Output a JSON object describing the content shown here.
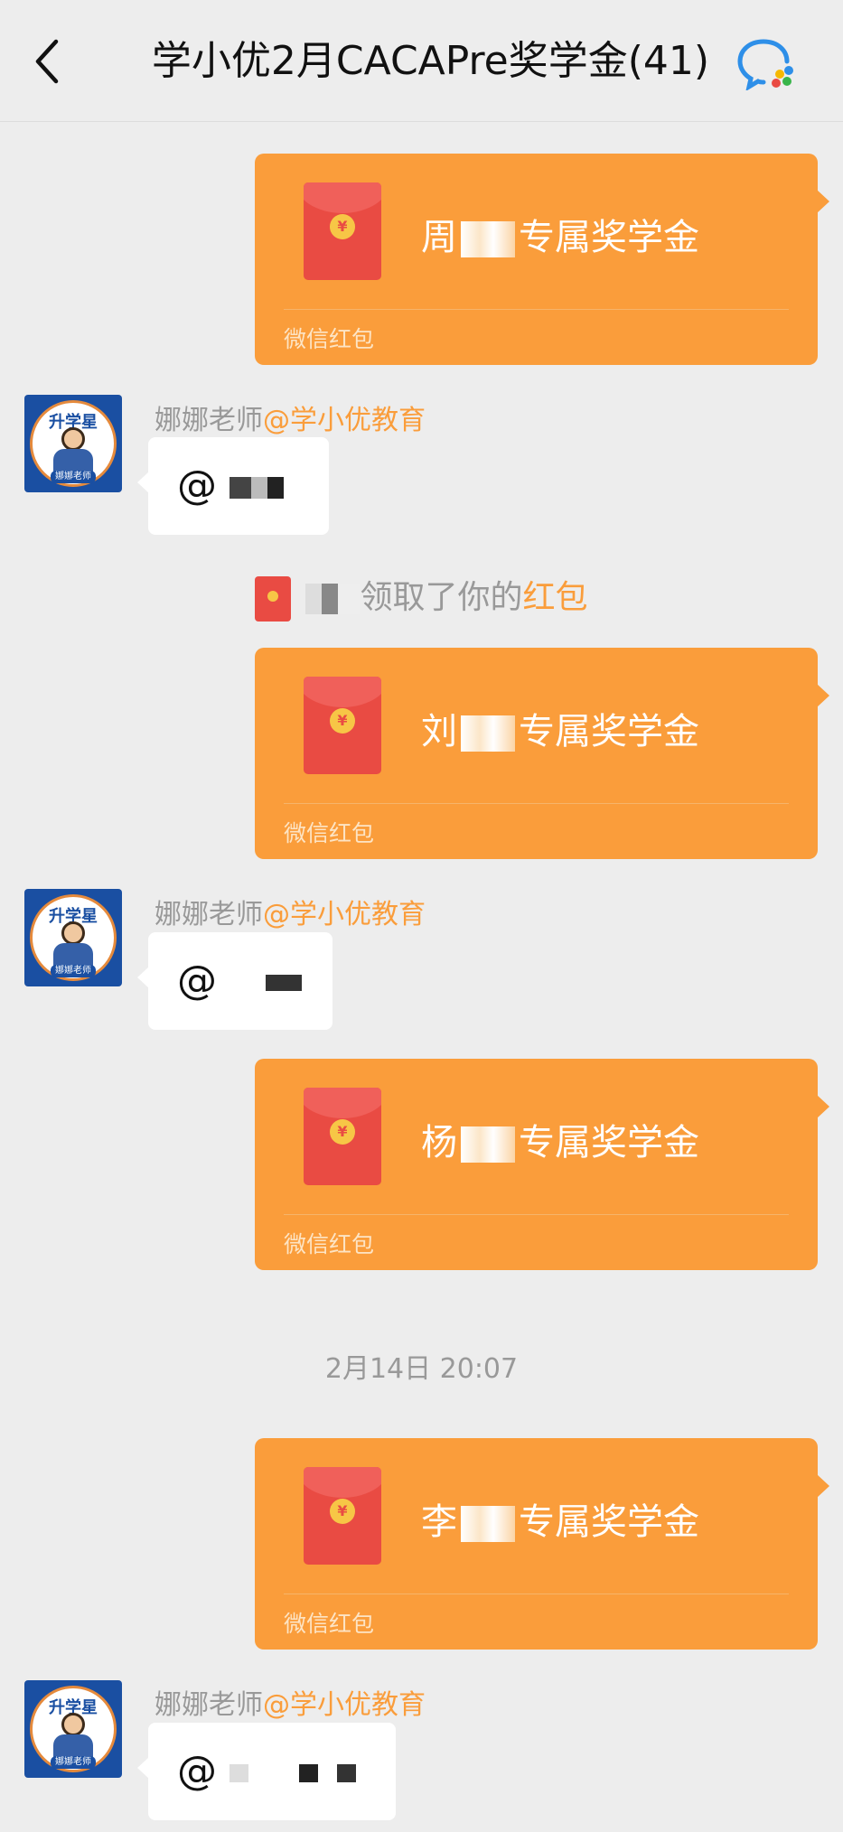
{
  "header": {
    "back_icon": "chevron-left-icon",
    "title": "学小优2月CACAPre奖学金(41)",
    "app_icon": "wecom-chat-icon"
  },
  "messages": [
    {
      "type": "red_packet",
      "name_prefix": "周",
      "suffix": "专属奖学金",
      "footer": "微信红包"
    },
    {
      "type": "text",
      "sender": "娜娜老师",
      "org": "@学小优教育",
      "text": "@"
    },
    {
      "type": "system",
      "text": "领取了你的",
      "highlight": "红包"
    },
    {
      "type": "red_packet",
      "name_prefix": "刘",
      "suffix": "专属奖学金",
      "footer": "微信红包"
    },
    {
      "type": "text",
      "sender": "娜娜老师",
      "org": "@学小优教育",
      "text": "@"
    },
    {
      "type": "red_packet",
      "name_prefix": "杨",
      "suffix": "专属奖学金",
      "footer": "微信红包"
    },
    {
      "type": "time",
      "text": "2月14日 20:07"
    },
    {
      "type": "red_packet",
      "name_prefix": "李",
      "suffix": "专属奖学金",
      "footer": "微信红包"
    },
    {
      "type": "text",
      "sender": "娜娜老师",
      "org": "@学小优教育",
      "text": "@"
    }
  ],
  "avatar": {
    "top": "升学星",
    "bottom": "娜娜老师"
  },
  "colors": {
    "red_packet": "#fa9d3b",
    "background": "#ededed",
    "envelope": "#e94b43",
    "accent": "#fa9d3b"
  }
}
